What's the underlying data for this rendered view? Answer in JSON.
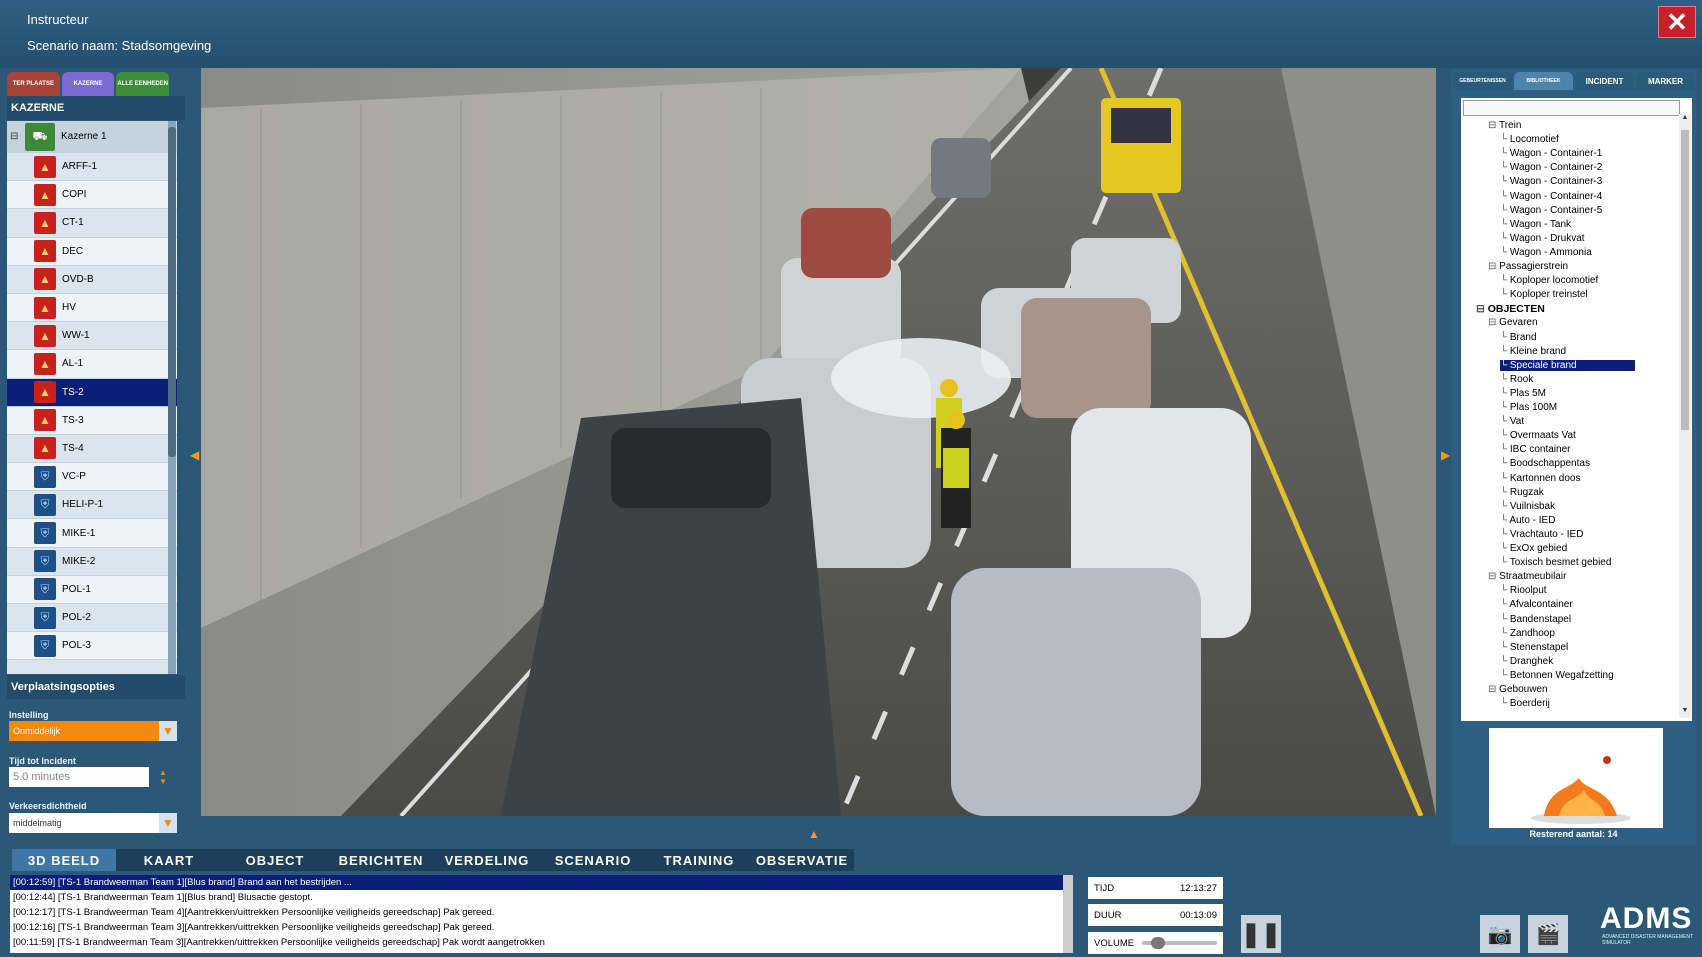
{
  "header": {
    "role": "Instructeur",
    "scenario": "Scenario naam: Stadsomgeving"
  },
  "left_tabs": [
    {
      "label": "TER PLAATSE",
      "color": "#a9433a"
    },
    {
      "label": "KAZERNE",
      "color": "#7b6bd0"
    },
    {
      "label": "ALLE EENHEDEN",
      "color": "#3c8d3c"
    }
  ],
  "kazerne_header": "KAZERNE",
  "kazerne_parent": "Kazerne 1",
  "units": [
    {
      "label": "ARFF-1",
      "icon": "fire-truck-icon",
      "kind": "fire"
    },
    {
      "label": "COPI",
      "icon": "fire-icon",
      "kind": "fire"
    },
    {
      "label": "CT-1",
      "icon": "fire-extinguisher-icon",
      "kind": "fire"
    },
    {
      "label": "DEC",
      "icon": "fire-icon",
      "kind": "fire"
    },
    {
      "label": "OVD-B",
      "icon": "fire-icon",
      "kind": "fire"
    },
    {
      "label": "HV",
      "icon": "fire-icon",
      "kind": "fire"
    },
    {
      "label": "WW-1",
      "icon": "water-icon",
      "kind": "fire"
    },
    {
      "label": "AL-1",
      "icon": "ladder-icon",
      "kind": "fire"
    },
    {
      "label": "TS-2",
      "icon": "fire-icon",
      "kind": "fire",
      "selected": true
    },
    {
      "label": "TS-3",
      "icon": "fire-icon",
      "kind": "fire"
    },
    {
      "label": "TS-4",
      "icon": "fire-icon",
      "kind": "fire"
    },
    {
      "label": "VC-P",
      "icon": "shield-icon",
      "kind": "police"
    },
    {
      "label": "HELI-P-1",
      "icon": "shield-icon",
      "kind": "police"
    },
    {
      "label": "MIKE-1",
      "icon": "shield-icon",
      "kind": "police"
    },
    {
      "label": "MIKE-2",
      "icon": "shield-icon",
      "kind": "police"
    },
    {
      "label": "POL-1",
      "icon": "shield-icon",
      "kind": "police"
    },
    {
      "label": "POL-2",
      "icon": "shield-icon",
      "kind": "police"
    },
    {
      "label": "POL-3",
      "icon": "shield-icon",
      "kind": "police"
    }
  ],
  "options": {
    "title": "Verplaatsingsopties",
    "instelling_label": "Instelling",
    "instelling_value": "Onmiddelijk",
    "tijd_label": "Tijd tot Incident",
    "tijd_value": "5.0 minutes",
    "verkeer_label": "Verkeersdichtheid",
    "verkeer_value": "middelmatig"
  },
  "right_tabs": [
    {
      "label": "GEBEURTENISSEN",
      "active": false
    },
    {
      "label": "BIBLIOTHEEK",
      "active": true
    },
    {
      "label": "INCIDENT",
      "active": false
    },
    {
      "label": "MARKER",
      "active": false
    }
  ],
  "library": [
    {
      "label": "Trein",
      "level": 1,
      "expander": true
    },
    {
      "label": "Locomotief",
      "level": 2
    },
    {
      "label": "Wagon - Container-1",
      "level": 2
    },
    {
      "label": "Wagon - Container-2",
      "level": 2
    },
    {
      "label": "Wagon - Container-3",
      "level": 2
    },
    {
      "label": "Wagon - Container-4",
      "level": 2
    },
    {
      "label": "Wagon - Container-5",
      "level": 2
    },
    {
      "label": "Wagon - Tank",
      "level": 2
    },
    {
      "label": "Wagon - Drukvat",
      "level": 2
    },
    {
      "label": "Wagon - Ammonia",
      "level": 2
    },
    {
      "label": "Passagierstrein",
      "level": 1,
      "expander": true
    },
    {
      "label": "Koploper locomotief",
      "level": 2
    },
    {
      "label": "Koploper treinstel",
      "level": 2
    },
    {
      "label": "OBJECTEN",
      "level": 0,
      "expander": true,
      "cat": true
    },
    {
      "label": "Gevaren",
      "level": 1,
      "expander": true
    },
    {
      "label": "Brand",
      "level": 2
    },
    {
      "label": "Kleine brand",
      "level": 2
    },
    {
      "label": "Speciale brand",
      "level": 2,
      "selected": true
    },
    {
      "label": "Rook",
      "level": 2
    },
    {
      "label": "Plas 5M",
      "level": 2
    },
    {
      "label": "Plas 100M",
      "level": 2
    },
    {
      "label": "Vat",
      "level": 2
    },
    {
      "label": "Overmaats Vat",
      "level": 2
    },
    {
      "label": "IBC container",
      "level": 2
    },
    {
      "label": "Boodschappentas",
      "level": 2
    },
    {
      "label": "Kartonnen doos",
      "level": 2
    },
    {
      "label": "Rugzak",
      "level": 2
    },
    {
      "label": "Vuilnisbak",
      "level": 2
    },
    {
      "label": "Auto - IED",
      "level": 2
    },
    {
      "label": "Vrachtauto - IED",
      "level": 2
    },
    {
      "label": "ExOx gebied",
      "level": 2
    },
    {
      "label": "Toxisch besmet gebied",
      "level": 2
    },
    {
      "label": "Straatmeubilair",
      "level": 1,
      "expander": true
    },
    {
      "label": "Rioolput",
      "level": 2
    },
    {
      "label": "Afvalcontainer",
      "level": 2
    },
    {
      "label": "Bandenstapel",
      "level": 2
    },
    {
      "label": "Zandhoop",
      "level": 2
    },
    {
      "label": "Stenenstapel",
      "level": 2
    },
    {
      "label": "Dranghek",
      "level": 2
    },
    {
      "label": "Betonnen Wegafzetting",
      "level": 2
    },
    {
      "label": "Gebouwen",
      "level": 1,
      "expander": true
    },
    {
      "label": "Boerderij",
      "level": 2
    }
  ],
  "remaining": "Resterend aantal: 14",
  "bottom_tabs": [
    {
      "label": "3D BEELD",
      "active": true
    },
    {
      "label": "KAART"
    },
    {
      "label": "OBJECT"
    },
    {
      "label": "BERICHTEN"
    },
    {
      "label": "VERDELING"
    },
    {
      "label": "SCENARIO"
    },
    {
      "label": "TRAINING"
    },
    {
      "label": "OBSERVATIE"
    }
  ],
  "log": [
    "[00:12:59] [TS-1 Brandweerman Team 1][Blus brand] Brand aan het bestrijden ...",
    "[00:12:44] [TS-1 Brandweerman Team 1][Blus brand] Blusactie gestopt.",
    "[00:12:17] [TS-1 Brandweerman Team 4][Aantrekken/uittrekken Persoonlijke veiligheids gereedschap] Pak gereed.",
    "[00:12:16] [TS-1 Brandweerman Team 3][Aantrekken/uittrekken Persoonlijke veiligheids gereedschap] Pak gereed.",
    "[00:11:59] [TS-1 Brandweerman Team 3][Aantrekken/uittrekken Persoonlijke veiligheids gereedschap] Pak wordt aangetrokken"
  ],
  "status": {
    "tijd_label": "TIJD",
    "tijd_value": "12:13:27",
    "duur_label": "DUUR",
    "duur_value": "00:13:09",
    "volume_label": "VOLUME",
    "volume_level": 0.2
  },
  "brand": {
    "name": "ADMS",
    "tagline": "ADVANCED DISASTER MANAGEMENT SIMULATOR"
  }
}
